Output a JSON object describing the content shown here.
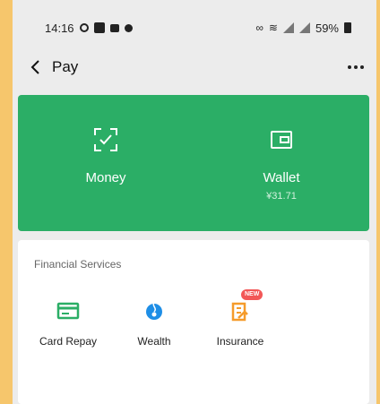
{
  "status_bar": {
    "time": "14:16",
    "battery": "59%"
  },
  "header": {
    "title": "Pay"
  },
  "pay_card": {
    "money_label": "Money",
    "wallet_label": "Wallet",
    "wallet_balance": "¥31.71"
  },
  "services": {
    "title": "Financial Services",
    "items": [
      {
        "label": "Card Repay",
        "icon": "card-icon"
      },
      {
        "label": "Wealth",
        "icon": "wealth-icon"
      },
      {
        "label": "Insurance",
        "icon": "insurance-icon",
        "badge": "NEW"
      }
    ]
  },
  "colors": {
    "brand_green": "#2bae66",
    "background": "#ececec",
    "frame": "#f6c66c",
    "wealth_blue": "#1e8ee6",
    "insurance_orange": "#f59b2b",
    "badge_red": "#f25757"
  }
}
